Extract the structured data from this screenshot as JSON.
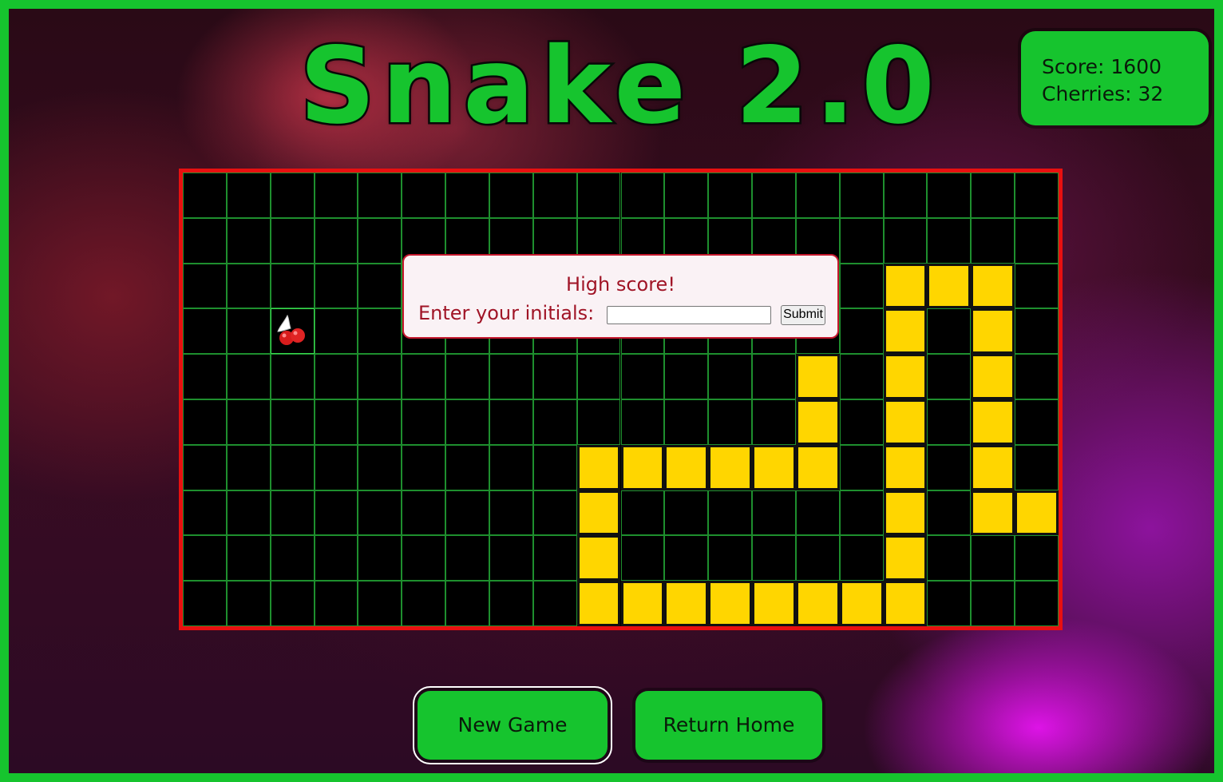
{
  "title": "Snake 2.0",
  "scoreboard": {
    "score_text": "Score: 1600",
    "cherries_text": "Cherries: 32"
  },
  "board": {
    "columns": 20,
    "rows": 10,
    "snake_cells": [
      [
        16,
        2
      ],
      [
        17,
        2
      ],
      [
        18,
        2
      ],
      [
        16,
        3
      ],
      [
        18,
        3
      ],
      [
        14,
        4
      ],
      [
        16,
        4
      ],
      [
        18,
        4
      ],
      [
        14,
        5
      ],
      [
        16,
        5
      ],
      [
        18,
        5
      ],
      [
        9,
        6
      ],
      [
        10,
        6
      ],
      [
        11,
        6
      ],
      [
        12,
        6
      ],
      [
        13,
        6
      ],
      [
        14,
        6
      ],
      [
        16,
        6
      ],
      [
        18,
        6
      ],
      [
        9,
        7
      ],
      [
        16,
        7
      ],
      [
        18,
        7
      ],
      [
        19,
        7
      ],
      [
        9,
        8
      ],
      [
        16,
        8
      ],
      [
        9,
        9
      ],
      [
        10,
        9
      ],
      [
        11,
        9
      ],
      [
        12,
        9
      ],
      [
        13,
        9
      ],
      [
        14,
        9
      ],
      [
        15,
        9
      ],
      [
        16,
        9
      ]
    ],
    "cherry_cell": [
      2,
      3
    ],
    "colors": {
      "snake": "#ffd600",
      "grid_line": "#1e8f2e",
      "border": "#e81010",
      "accent": "#16c42e"
    }
  },
  "dialog": {
    "title": "High score!",
    "label": "Enter your initials:",
    "input_value": "",
    "submit_label": "Submit"
  },
  "buttons": {
    "new_game": "New Game",
    "return_home": "Return Home"
  }
}
